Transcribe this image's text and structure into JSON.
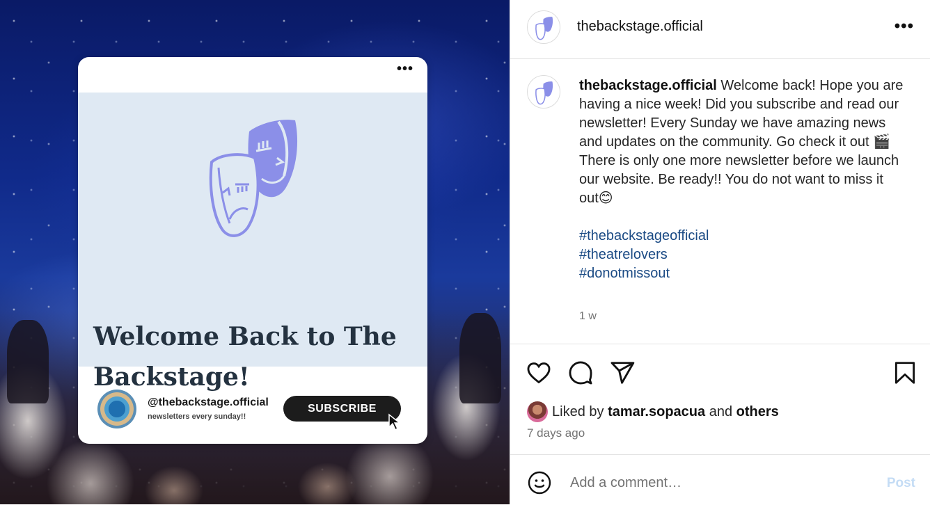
{
  "post_image": {
    "card": {
      "menu_glyph": "•••",
      "heading": "Welcome Back to The Backstage!",
      "handle": "@thebackstage.official",
      "subtitle": "newsletters every sunday!!",
      "subscribe_label": "SUBSCRIBE",
      "mask_color": "#8b8fe8"
    }
  },
  "header": {
    "username": "thebackstage.official",
    "more_glyph": "•••",
    "avatar_icon": "theatre-masks-icon"
  },
  "caption": {
    "username": "thebackstage.official",
    "lines": {
      "l1": "Welcome back! Hope you are having a nice week! Did you subscribe and read our newsletter! Every Sunday we have amazing news and updates on the community. Go check it out 🎬",
      "l2": "There is only one more newsletter before we launch our website. Be ready!! You do not want to miss it out😊"
    },
    "hashtags": [
      "#thebackstageofficial",
      "#theatrelovers",
      "#donotmissout"
    ],
    "time_ago": "1 w"
  },
  "actions": {
    "icons": [
      "heart-icon",
      "comment-icon",
      "share-icon",
      "bookmark-icon"
    ],
    "liked_by_prefix": "Liked by",
    "liked_by_user": "tamar.sopacua",
    "liked_by_and": "and",
    "liked_by_others": "others",
    "date": "7 days ago"
  },
  "comment": {
    "placeholder": "Add a comment…",
    "post_label": "Post"
  },
  "colors": {
    "hashtag": "#1a4a84",
    "post_button_disabled": "#c4dcf5",
    "mask": "#8b8fe8"
  }
}
